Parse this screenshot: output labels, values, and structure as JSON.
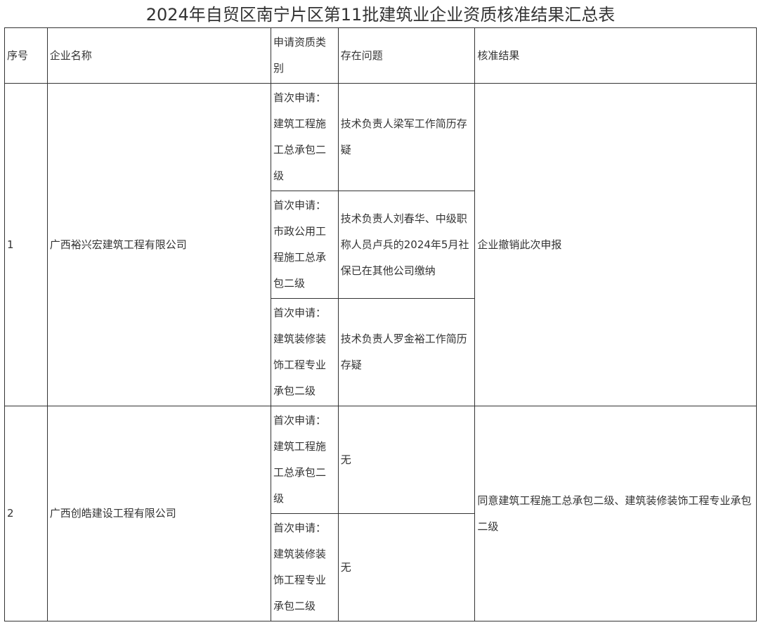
{
  "title": "2024年自贸区南宁片区第11批建筑业企业资质核准结果汇总表",
  "headers": {
    "seq": "序号",
    "company": "企业名称",
    "type": "申请资质类别",
    "issue": "存在问题",
    "result": "核准结果"
  },
  "companies": [
    {
      "seq": "1",
      "name": "广西裕兴宏建筑工程有限公司",
      "result": "企业撤销此次申报",
      "items": [
        {
          "type": "首次申请：建筑工程施工总承包二级",
          "issue": "技术负责人梁军工作简历存疑"
        },
        {
          "type": "首次申请：市政公用工程施工总承包二级",
          "issue": "技术负责人刘春华、中级职称人员卢兵的2024年5月社保已在其他公司缴纳"
        },
        {
          "type": "首次申请：建筑装修装饰工程专业承包二级",
          "issue": "技术负责人罗金裕工作简历存疑"
        }
      ]
    },
    {
      "seq": "2",
      "name": "广西创皓建设工程有限公司",
      "result": "同意建筑工程施工总承包二级、建筑装修装饰工程专业承包二级",
      "items": [
        {
          "type": "首次申请：建筑工程施工总承包二级",
          "issue": "无"
        },
        {
          "type": "首次申请：建筑装修装饰工程专业承包二级",
          "issue": "无"
        }
      ]
    }
  ]
}
